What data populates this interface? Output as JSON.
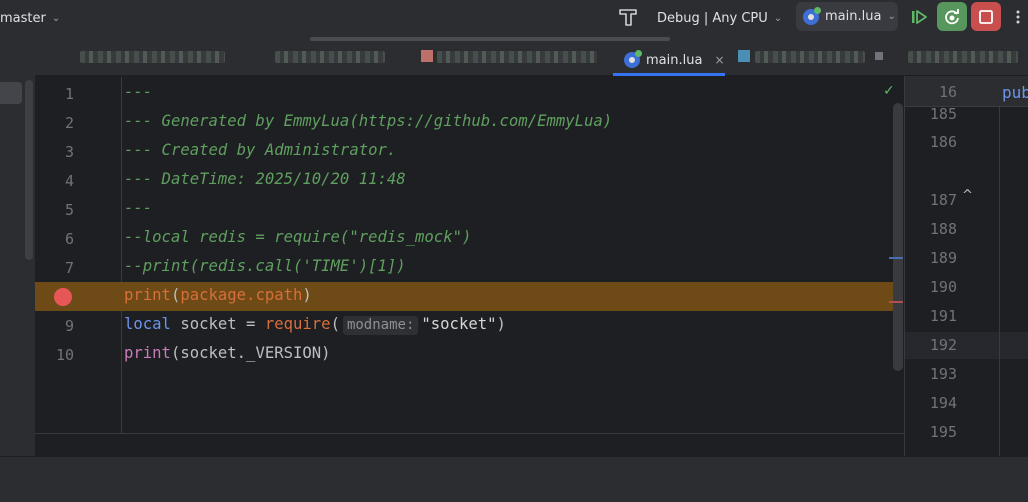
{
  "toolbar": {
    "branch": "master",
    "build_icon": "hammer-icon",
    "run_config": "Debug | Any CPU",
    "run_file": "main.lua",
    "resume_icon": "resume-icon",
    "rerun_icon": "rerun-debug-icon",
    "stop_icon": "stop-icon",
    "more_icon": "more-vertical-icon"
  },
  "tabs": {
    "active": "main.lua",
    "close_glyph": "×"
  },
  "editor": {
    "lines": [
      {
        "n": "1",
        "breakpoint": false,
        "highlighted": false
      },
      {
        "n": "2",
        "breakpoint": false,
        "highlighted": false
      },
      {
        "n": "3",
        "breakpoint": false,
        "highlighted": false
      },
      {
        "n": "4",
        "breakpoint": false,
        "highlighted": false
      },
      {
        "n": "5",
        "breakpoint": false,
        "highlighted": false
      },
      {
        "n": "6",
        "breakpoint": false,
        "highlighted": false
      },
      {
        "n": "7",
        "breakpoint": false,
        "highlighted": false
      },
      {
        "n": "8",
        "breakpoint": true,
        "highlighted": true
      },
      {
        "n": "9",
        "breakpoint": false,
        "highlighted": false
      },
      {
        "n": "10",
        "breakpoint": false,
        "highlighted": false
      }
    ],
    "code": {
      "l1": "---",
      "l2": "--- Generated by EmmyLua(https://github.com/EmmyLua)",
      "l3": "--- Created by Administrator.",
      "l4": "--- DateTime: 2025/10/20 11:48",
      "l5": "---",
      "l6": "--local redis = require(\"redis_mock\")",
      "l7": "--print(redis.call('TIME')[1])",
      "l8_fn": "print",
      "l8_open": "(",
      "l8_arg": "package.cpath",
      "l8_close": ")",
      "l9_kw": "local",
      "l9_mid": " socket = ",
      "l9_fn": "require",
      "l9_open": "(",
      "l9_hint": "modname:",
      "l9_str": "\"socket\"",
      "l9_close": ")",
      "l10_fn": "print",
      "l10_rest": "(socket._VERSION)"
    },
    "inspection_ok": "✓"
  },
  "right_pane": {
    "sticky_line": "16",
    "sticky_code": "pub",
    "line_numbers": [
      "185",
      "186",
      "187",
      "188",
      "189",
      "190",
      "191",
      "192",
      "193",
      "194",
      "195"
    ],
    "fold_glyph": "^"
  }
}
